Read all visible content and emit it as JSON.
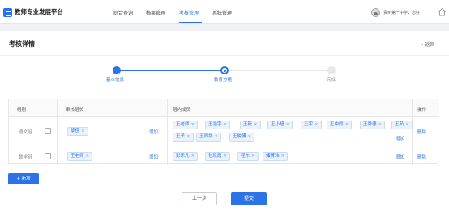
{
  "header": {
    "brand": "教师专业发展平台",
    "nav": [
      "综合查询",
      "档案管理",
      "考核管理",
      "系统管理"
    ],
    "active_nav": "考核管理",
    "user": "贵州第一中学，您好"
  },
  "page": {
    "title": "考核详情",
    "back_label": "返回",
    "steps": [
      {
        "label": "基本信息",
        "status": "done"
      },
      {
        "label": "教育分组",
        "status": "current"
      },
      {
        "label": "完成",
        "status": "todo"
      }
    ]
  },
  "table": {
    "headers": [
      "组别",
      "审核组长",
      "组内成员",
      "操作"
    ],
    "rows": [
      {
        "group": "语文组",
        "leaders": [
          "黎佳"
        ],
        "add_leader_label": "增加",
        "members": [
          "王老师",
          "王浩宇",
          "王筱",
          "王小超",
          "王宇",
          "王中同",
          "王秀德",
          "王茹",
          "王子",
          "王四华",
          "王俊博"
        ],
        "add_member_label": "增加",
        "action": "删除"
      },
      {
        "group": "数学组",
        "leaders": [
          "王老师"
        ],
        "add_leader_label": "增加",
        "members": [
          "彭乐凡",
          "包欢霞",
          "程东",
          "储菁玮"
        ],
        "add_member_label": "增加",
        "action": "删除"
      }
    ]
  },
  "buttons": {
    "add": "+ 新增",
    "prev": "上一步",
    "submit": "提交"
  },
  "colors": {
    "accent": "#2b73e6",
    "tag_bg": "#eaf2fe"
  }
}
